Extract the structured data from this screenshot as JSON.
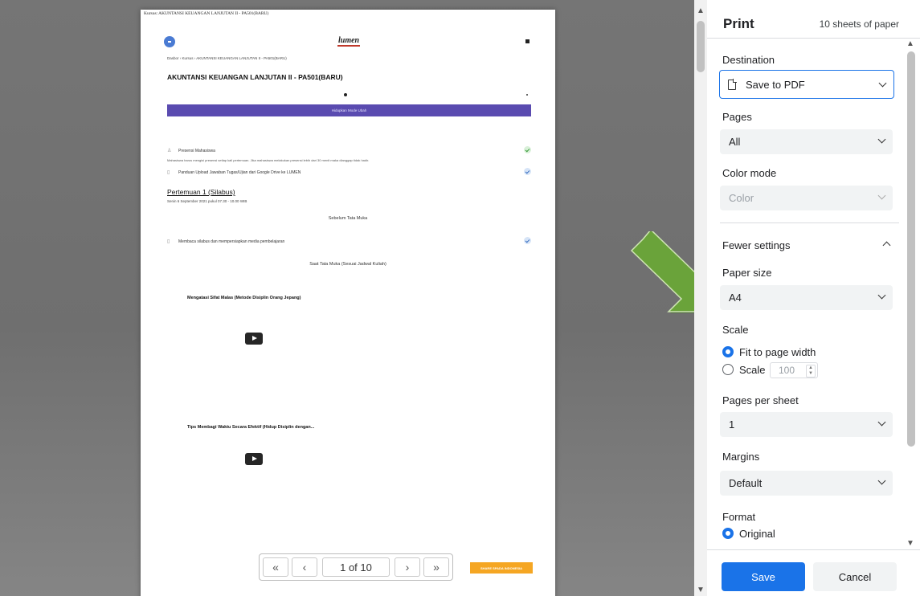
{
  "document": {
    "print_header": "Kursus: AKUNTANSI KEUANGAN LANJUTAN II - PA501(BARU)",
    "logo": "lumen",
    "breadcrumb": "Dasbor  ›  Kursus  ›  AKUNTANSI KEUANGAN LANJUTAN II - PA501(BARU)",
    "course_title": "AKUNTANSI KEUANGAN LANJUTAN II - PA501(BARU)",
    "banner": "Hidupkan Mode Ubah",
    "presensi_label": "Presensi Mahasiswa",
    "presensi_note": "Mahasiswa harus mengisi presensi setiap kali pertemuan. Jika mahasiswa melakukan presensi lebih dari 30 menit maka dianggap tidak hadir.",
    "panduan_label": "Panduan Upload Jawaban Tugas/Ujian dari Google Drive ke LUMEN",
    "pertemuan_title": "Pertemuan 1 (Silabus)",
    "pertemuan_date": "Senin 6 September 2021 pukul 07.30 - 10.00 WIB",
    "sebelum_label": "Sebelum Tata Muka",
    "silabus_label": "Membaca silabus dan mempersiapkan media pembelajaran",
    "saat_label": "Saat Tata Muka (Sesuai Jadwal Kuliah)",
    "video1_title": "Mengatasi Sifat Malas (Metode Disiplin Orang Jepang)",
    "video2_title": "Tips Membagi Waktu Secara Efektif (Hidup Disiplin dengan...",
    "footer_badge": "SHARE SPADA INDONESIA"
  },
  "page_nav": {
    "first": "«",
    "prev": "‹",
    "indicator": "1 of 10",
    "next": "›",
    "last": "»"
  },
  "panel": {
    "title": "Print",
    "sheets": "10 sheets of paper",
    "destination_label": "Destination",
    "destination_value": "Save to PDF",
    "pages_label": "Pages",
    "pages_value": "All",
    "color_mode_label": "Color mode",
    "color_mode_value": "Color",
    "fewer_settings": "Fewer settings",
    "paper_size_label": "Paper size",
    "paper_size_value": "A4",
    "scale_label": "Scale",
    "scale_option_fit": "Fit to page width",
    "scale_option_custom": "Scale",
    "scale_value": "100",
    "pages_per_sheet_label": "Pages per sheet",
    "pages_per_sheet_value": "1",
    "margins_label": "Margins",
    "margins_value": "Default",
    "format_label": "Format",
    "format_option": "Original",
    "save_button": "Save",
    "cancel_button": "Cancel"
  },
  "colors": {
    "accent": "#1a73e8",
    "banner": "#5a4bb0",
    "arrow": "#6aa33a",
    "badge": "#f5a623"
  }
}
